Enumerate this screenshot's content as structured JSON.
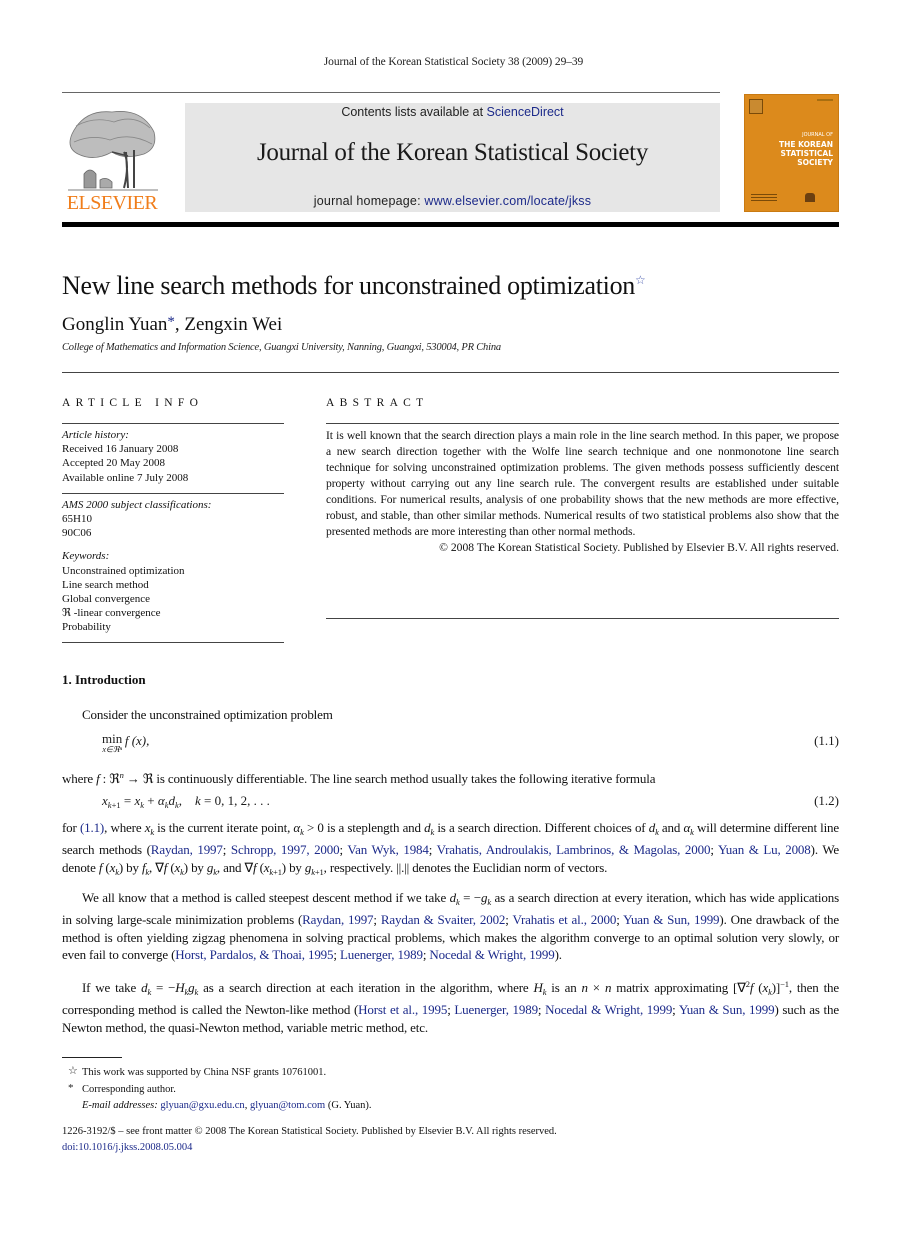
{
  "running_head": "Journal of the Korean Statistical Society 38 (2009) 29–39",
  "masthead": {
    "publisher_logo_text": "ELSEVIER",
    "contents_prefix": "Contents lists available at ",
    "contents_link": "ScienceDirect",
    "journal_name": "Journal of the Korean Statistical Society",
    "homepage_prefix": "journal homepage: ",
    "homepage_link": "www.elsevier.com/locate/jkss",
    "cover": {
      "title_small": "JOURNAL OF",
      "title_line1": "THE KOREAN",
      "title_line2": "STATISTICAL",
      "title_line3": "SOCIETY",
      "color": "#dc8a1c"
    }
  },
  "article": {
    "title": "New line search methods for unconstrained optimization",
    "title_mark": "☆",
    "author1": "Gonglin Yuan",
    "author1_mark": "*",
    "author_sep": ", ",
    "author2": "Zengxin Wei",
    "affiliation": "College of Mathematics and Information Science, Guangxi University, Nanning, Guangxi, 530004, PR China"
  },
  "article_info": {
    "heading": "ARTICLE INFO",
    "history_label": "Article history:",
    "received": "Received 16 January 2008",
    "accepted": "Accepted 20 May 2008",
    "online": "Available online 7 July 2008",
    "ams_label": "AMS 2000 subject classifications:",
    "ams_codes": [
      "65H10",
      "90C06"
    ],
    "keywords_label": "Keywords:",
    "keywords": [
      "Unconstrained optimization",
      "Line search method",
      "Global convergence",
      "ℜ -linear convergence",
      "Probability"
    ]
  },
  "abstract": {
    "heading": "ABSTRACT",
    "text": "It is well known that the search direction plays a main role in the line search method. In this paper, we propose a new search direction together with the Wolfe line search technique and one nonmonotone line search technique for solving unconstrained optimization problems. The given methods possess sufficiently descent property without carrying out any line search rule. The convergent results are established under suitable conditions. For numerical results, analysis of one probability shows that the new methods are more effective, robust, and stable, than other similar methods. Numerical results of two statistical problems also show that the presented methods are more interesting than other normal methods.",
    "copyright": "© 2008 The Korean Statistical Society. Published by Elsevier B.V. All rights reserved."
  },
  "intro": {
    "heading": "1.  Introduction",
    "p1": "Consider the unconstrained optimization problem",
    "eq1_op": "min",
    "eq1_under": "x∈ℜⁿ",
    "eq1_body": "f (x),",
    "eq1_num": "(1.1)",
    "p2_a": "where ",
    "p2_b": " is continuously differentiable. The line search method usually takes the following iterative formula",
    "eq2_num": "(1.2)",
    "p3_for": "for ",
    "p3_ref": "(1.1)",
    "p3_a": ", where ",
    "p3_b": " is the current iterate point, ",
    "p3_c": " is a steplength and ",
    "p3_d": " is a search direction. Different choices of ",
    "p3_e": " and ",
    "p3_f": " will determine different line search methods (",
    "p3_refs": [
      "Raydan, 1997",
      "Schropp, 1997, 2000",
      "Van Wyk, 1984",
      "Vrahatis, Androulakis, Lambrinos, & Magolas, 2000",
      "Yuan & Lu, 2008"
    ],
    "p3_g": "). We denote ",
    "p3_h": " by ",
    "p3_i": ", and ",
    "p3_j": ", respectively. ||.|| denotes the Euclidian norm of vectors.",
    "p4_a": "We all know that a method is called steepest descent method if we take ",
    "p4_b": " as a search direction at every iteration, which has wide applications in solving large-scale minimization problems (",
    "p4_refs1": [
      "Raydan, 1997",
      "Raydan & Svaiter, 2002",
      "Vrahatis et al., 2000",
      "Yuan & Sun, 1999"
    ],
    "p4_c": "). One drawback of the method is often yielding zigzag phenomena in solving practical problems, which makes the algorithm converge to an optimal solution very slowly, or even fail to converge (",
    "p4_refs2": [
      "Horst, Pardalos, & Thoai, 1995",
      "Luenerger, 1989",
      "Nocedal & Wright, 1999"
    ],
    "p4_d": ").",
    "p5_a": "If we take ",
    "p5_b": " as a search direction at each iteration in the algorithm, where ",
    "p5_c": " is an ",
    "p5_d": " matrix approximating ",
    "p5_e": ", then the corresponding method is called the Newton-like method (",
    "p5_refs": [
      "Horst et al., 1995",
      "Luenerger, 1989",
      "Nocedal & Wright, 1999",
      "Yuan & Sun, 1999"
    ],
    "p5_f": ") such as the Newton method, the quasi-Newton method, variable metric method, etc."
  },
  "footnotes": {
    "fn1_mark": "☆",
    "fn1": "This work was supported by China NSF grants 10761001.",
    "fn2_mark": "*",
    "fn2": "Corresponding author.",
    "email_label": "E-mail addresses:",
    "email1": "glyuan@gxu.edu.cn",
    "email2": "glyuan@tom.com",
    "email_suffix": " (G. Yuan).",
    "front_matter": "1226-3192/$ – see front matter © 2008 The Korean Statistical Society. Published by Elsevier B.V. All rights reserved.",
    "doi": "doi:10.1016/j.jkss.2008.05.004"
  },
  "colors": {
    "link": "#1c2a8a",
    "elsevier_orange": "#f07d1a",
    "masthead_bg": "#e6e6e6"
  }
}
